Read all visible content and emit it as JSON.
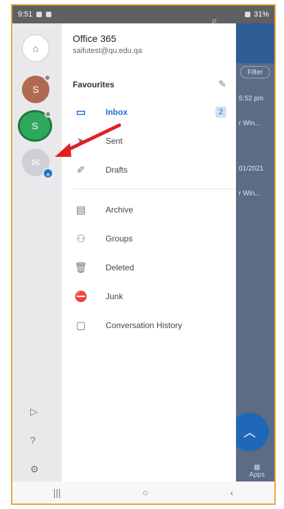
{
  "status": {
    "time": "9:51",
    "battery": "31%"
  },
  "behind": {
    "filter": "Filter",
    "time1": "5:52 pm",
    "snippet1": "r Win...",
    "date2": "01/2021",
    "snippet2": "r Win...",
    "apps": "Apps"
  },
  "rail": {
    "home_icon": "home-icon",
    "acct1_initial": "S",
    "acct2_initial": "S",
    "mail_icon": "mail-icon",
    "bottom_icons": [
      "play-icon",
      "help-icon",
      "settings-icon"
    ]
  },
  "drawer": {
    "account_name": "Office 365",
    "account_email": "saifutest@qu.edu.qa",
    "favourites_label": "Favourites",
    "items": [
      {
        "label": "Inbox",
        "icon": "inbox-icon",
        "count": "2"
      },
      {
        "label": "Sent",
        "icon": "send-icon"
      },
      {
        "label": "Drafts",
        "icon": "drafts-icon"
      },
      {
        "label": "Archive",
        "icon": "archive-icon"
      },
      {
        "label": "Groups",
        "icon": "groups-icon"
      },
      {
        "label": "Deleted",
        "icon": "trash-icon"
      },
      {
        "label": "Junk",
        "icon": "junk-icon"
      },
      {
        "label": "Conversation History",
        "icon": "folder-icon"
      }
    ]
  },
  "colors": {
    "accent": "#1f6fd0",
    "annotation": "#e02020",
    "frame": "#e8a53c"
  }
}
